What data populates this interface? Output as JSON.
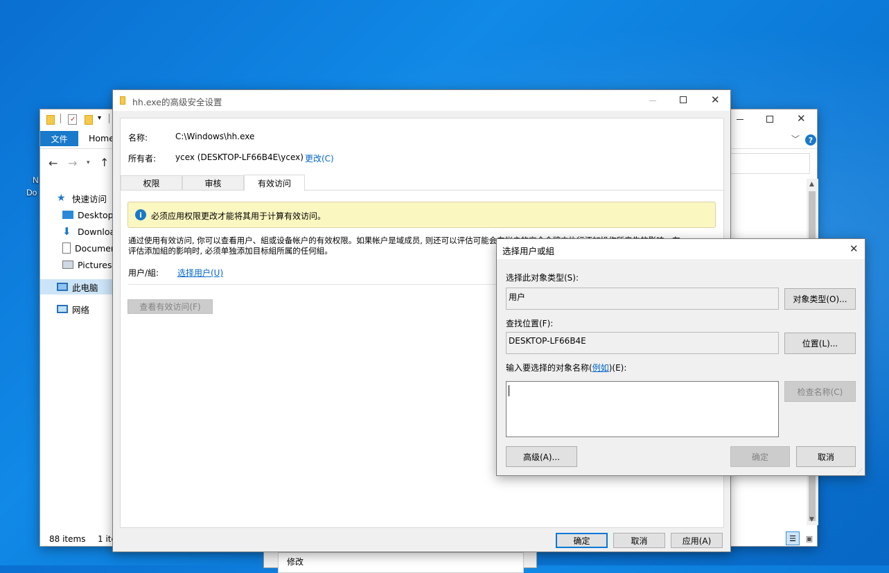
{
  "desktop": {
    "labels": [
      "N",
      "Do"
    ]
  },
  "explorer": {
    "ribbon_tabs": [
      "文件",
      "Home"
    ],
    "nav": {
      "quick_access": "快速访问",
      "items": [
        "Desktop",
        "Downloa",
        "Documer",
        "Pictures"
      ],
      "this_pc": "此电脑",
      "network": "网络"
    },
    "status": {
      "items": "88 items",
      "selected": "1 ite"
    },
    "bottom_item": "修改"
  },
  "adv": {
    "title": "hh.exe的高级安全设置",
    "name_label": "名称:",
    "name_value": "C:\\Windows\\hh.exe",
    "owner_label": "所有者:",
    "owner_value": "ycex (DESKTOP-LF66B4E\\ycex)",
    "owner_change": "更改(C)",
    "tabs": [
      "权限",
      "审核",
      "有效访问"
    ],
    "info_text": "必须应用权限更改才能将其用于计算有效访问。",
    "desc_line1": "通过使用有效访问, 你可以查看用户、組或设备帐户的有效权限。如果帐户是域成员, 则还可以评估可能会向帐户的安全令牌中执行添加操作所产生的影响。在",
    "desc_line2": "评估添加組的影响时, 必须单独添加目标組所属的任何組。",
    "user_group_label": "用户/組:",
    "select_user_link": "选择用户(U)",
    "view_access_button": "查看有效访问(F)",
    "ok": "确定",
    "cancel": "取消",
    "apply": "应用(A)"
  },
  "select_dialog": {
    "title": "选择用户或組",
    "object_type_label": "选择此对象类型(S):",
    "object_type_value": "用户",
    "object_types_button": "对象类型(O)...",
    "location_label": "查找位置(F):",
    "location_value": "DESKTOP-LF66B4E",
    "location_button": "位置(L)...",
    "names_label_pre": "输入要选择的对象名称(",
    "names_label_link": "例如",
    "names_label_post": ")(E):",
    "check_names_button": "检查名称(C)",
    "advanced_button": "高级(A)...",
    "ok": "确定",
    "cancel": "取消"
  }
}
